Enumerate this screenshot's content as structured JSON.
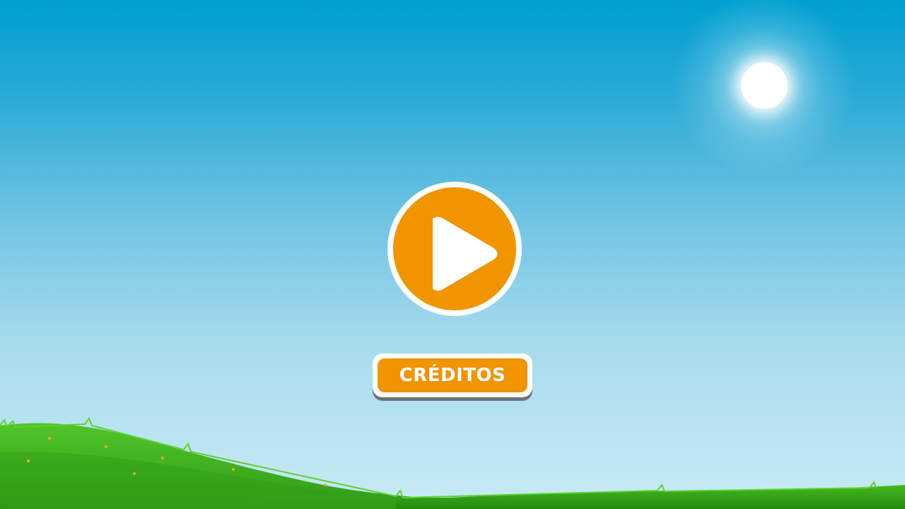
{
  "menu": {
    "play_button": {
      "icon": "play-icon",
      "color": "#f09400"
    },
    "credits_button": {
      "label": "CRÉDITOS",
      "color": "#f09400"
    }
  },
  "scene": {
    "sky_top_color": "#00a0d0",
    "sky_bottom_color": "#c7ebf4",
    "grass_color": "#3cb81f",
    "sun_color": "#ffffff"
  }
}
